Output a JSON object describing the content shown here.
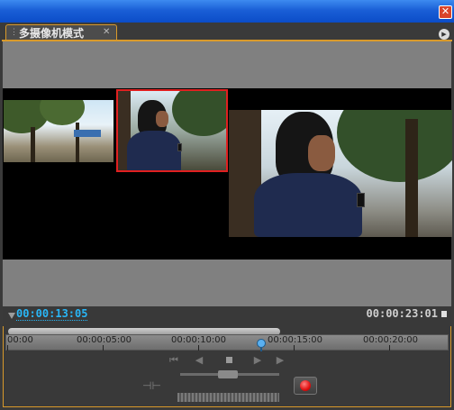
{
  "window": {
    "close_glyph": "✕"
  },
  "panel": {
    "tab_title": "多摄像机模式",
    "tab_grip_icon": "grip-icon",
    "tab_close_glyph": "✕",
    "menu_glyph": "▶",
    "accent_color": "#d99a2b"
  },
  "monitor": {
    "cameras": [
      {
        "id": "camera-1",
        "selected": false
      },
      {
        "id": "camera-2",
        "selected": true
      },
      {
        "id": "program",
        "selected": false
      }
    ],
    "selection_color": "#e02020"
  },
  "timecode": {
    "current": "00:00:13:05",
    "duration": "00:00:23:01",
    "current_color": "#29b6f6"
  },
  "ruler": {
    "labels": [
      "00:00",
      "00:00:05:00",
      "00:00:10:00",
      "00:00:15:00",
      "00:00:20:00"
    ],
    "playhead_time": "00:00:13:05"
  },
  "transport": {
    "step_back_glyph": "⏮",
    "frame_back_glyph": "◀",
    "play_glyph": "▶",
    "frame_forward_glyph": "▶",
    "split_glyph": "⊣⊢",
    "record_color": "#e01010"
  }
}
